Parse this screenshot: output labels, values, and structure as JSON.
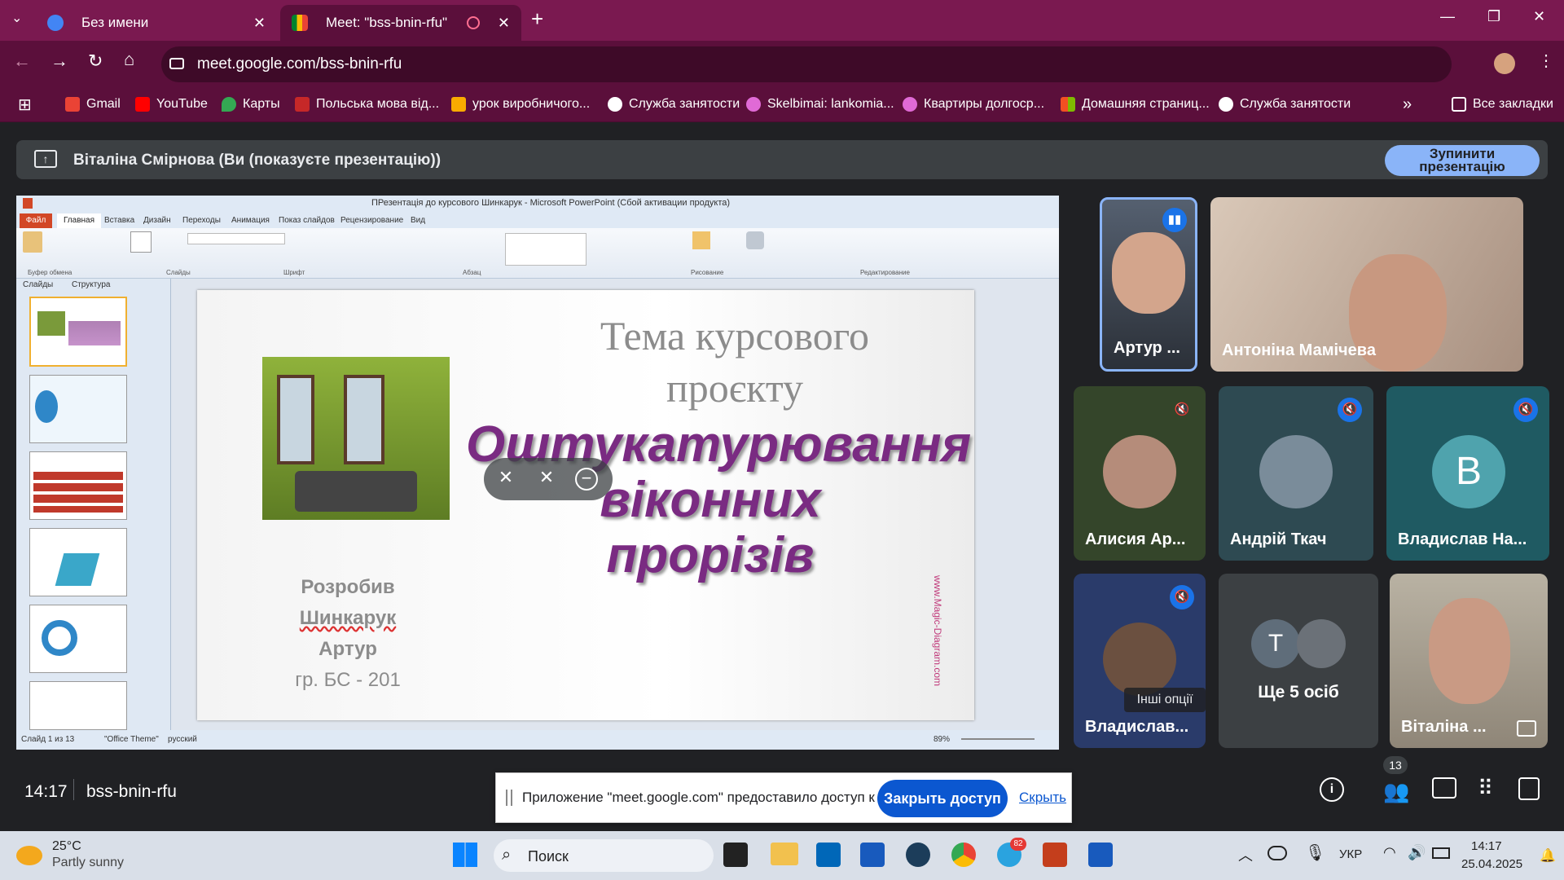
{
  "browser": {
    "tabs": [
      {
        "title": "Без имени"
      },
      {
        "title": "Meet: \"bss-bnin-rfu\""
      }
    ],
    "url": "meet.google.com/bss-bnin-rfu",
    "bookmarks": [
      "Gmail",
      "YouTube",
      "Карты",
      "Польська мова від...",
      "урок виробничого...",
      "Служба занятости",
      "Skelbimai: lankomia...",
      "Квартиры долгоср...",
      "Домашняя страниц...",
      "Служба занятости"
    ],
    "all_bookmarks": "Все закладки",
    "colors": {
      "frame": "#7a1950",
      "toolbar": "#5b0f3b"
    }
  },
  "meet": {
    "presenter_banner": "Віталіна Смірнова (Ви (показуєте презентацію))",
    "stop_button": "Зупинити презентацію",
    "time": "14:17",
    "meeting_code": "bss-bnin-rfu",
    "participants_count": "13",
    "share_notice": "Приложение \"meet.google.com\" предоставило доступ к окну.",
    "stop_access": "Закрыть доступ",
    "hide": "Скрыть",
    "more_options": "Інші опції",
    "participants": [
      {
        "name": "Артур ..."
      },
      {
        "name": "Антоніна Мамічева"
      },
      {
        "name": "Алисия Ар..."
      },
      {
        "name": "Андрій Ткач"
      },
      {
        "name": "Владислав На...",
        "initial": "В"
      },
      {
        "name": "Владислав..."
      },
      {
        "name": "Ще 5 осіб",
        "initial": "Т"
      },
      {
        "name": "Віталіна ..."
      }
    ]
  },
  "ppt": {
    "title": "ПРезентація до курсового Шинкарук - Microsoft PowerPoint (Сбой активации продукта)",
    "tabs": [
      "Файл",
      "Главная",
      "Вставка",
      "Дизайн",
      "Переходы",
      "Анимация",
      "Показ слайдов",
      "Рецензирование",
      "Вид"
    ],
    "groups": [
      "Буфер обмена",
      "Слайды",
      "Шрифт",
      "Абзац",
      "Рисование",
      "Редактирование"
    ],
    "panel_tabs": [
      "Слайды",
      "Структура"
    ],
    "status": {
      "slide": "Слайд 1 из 13",
      "theme": "\"Office Theme\"",
      "lang": "русский",
      "zoom": "89%"
    },
    "slide": {
      "topic1": "Тема курсового",
      "topic2": "проєкту",
      "main1": "Оштукатурювання",
      "main2": "віконних",
      "main3": "прорізів",
      "author1": "Розробив",
      "author2": "Шинкарук",
      "author3": "Артур",
      "group": "гр. БС - 201",
      "watermark": "www.Magic-Diagram.com"
    }
  },
  "taskbar": {
    "temp": "25°C",
    "weather": "Partly sunny",
    "search": "Поиск",
    "lang": "УКР",
    "time": "14:17",
    "date": "25.04.2025",
    "badge": "82"
  }
}
